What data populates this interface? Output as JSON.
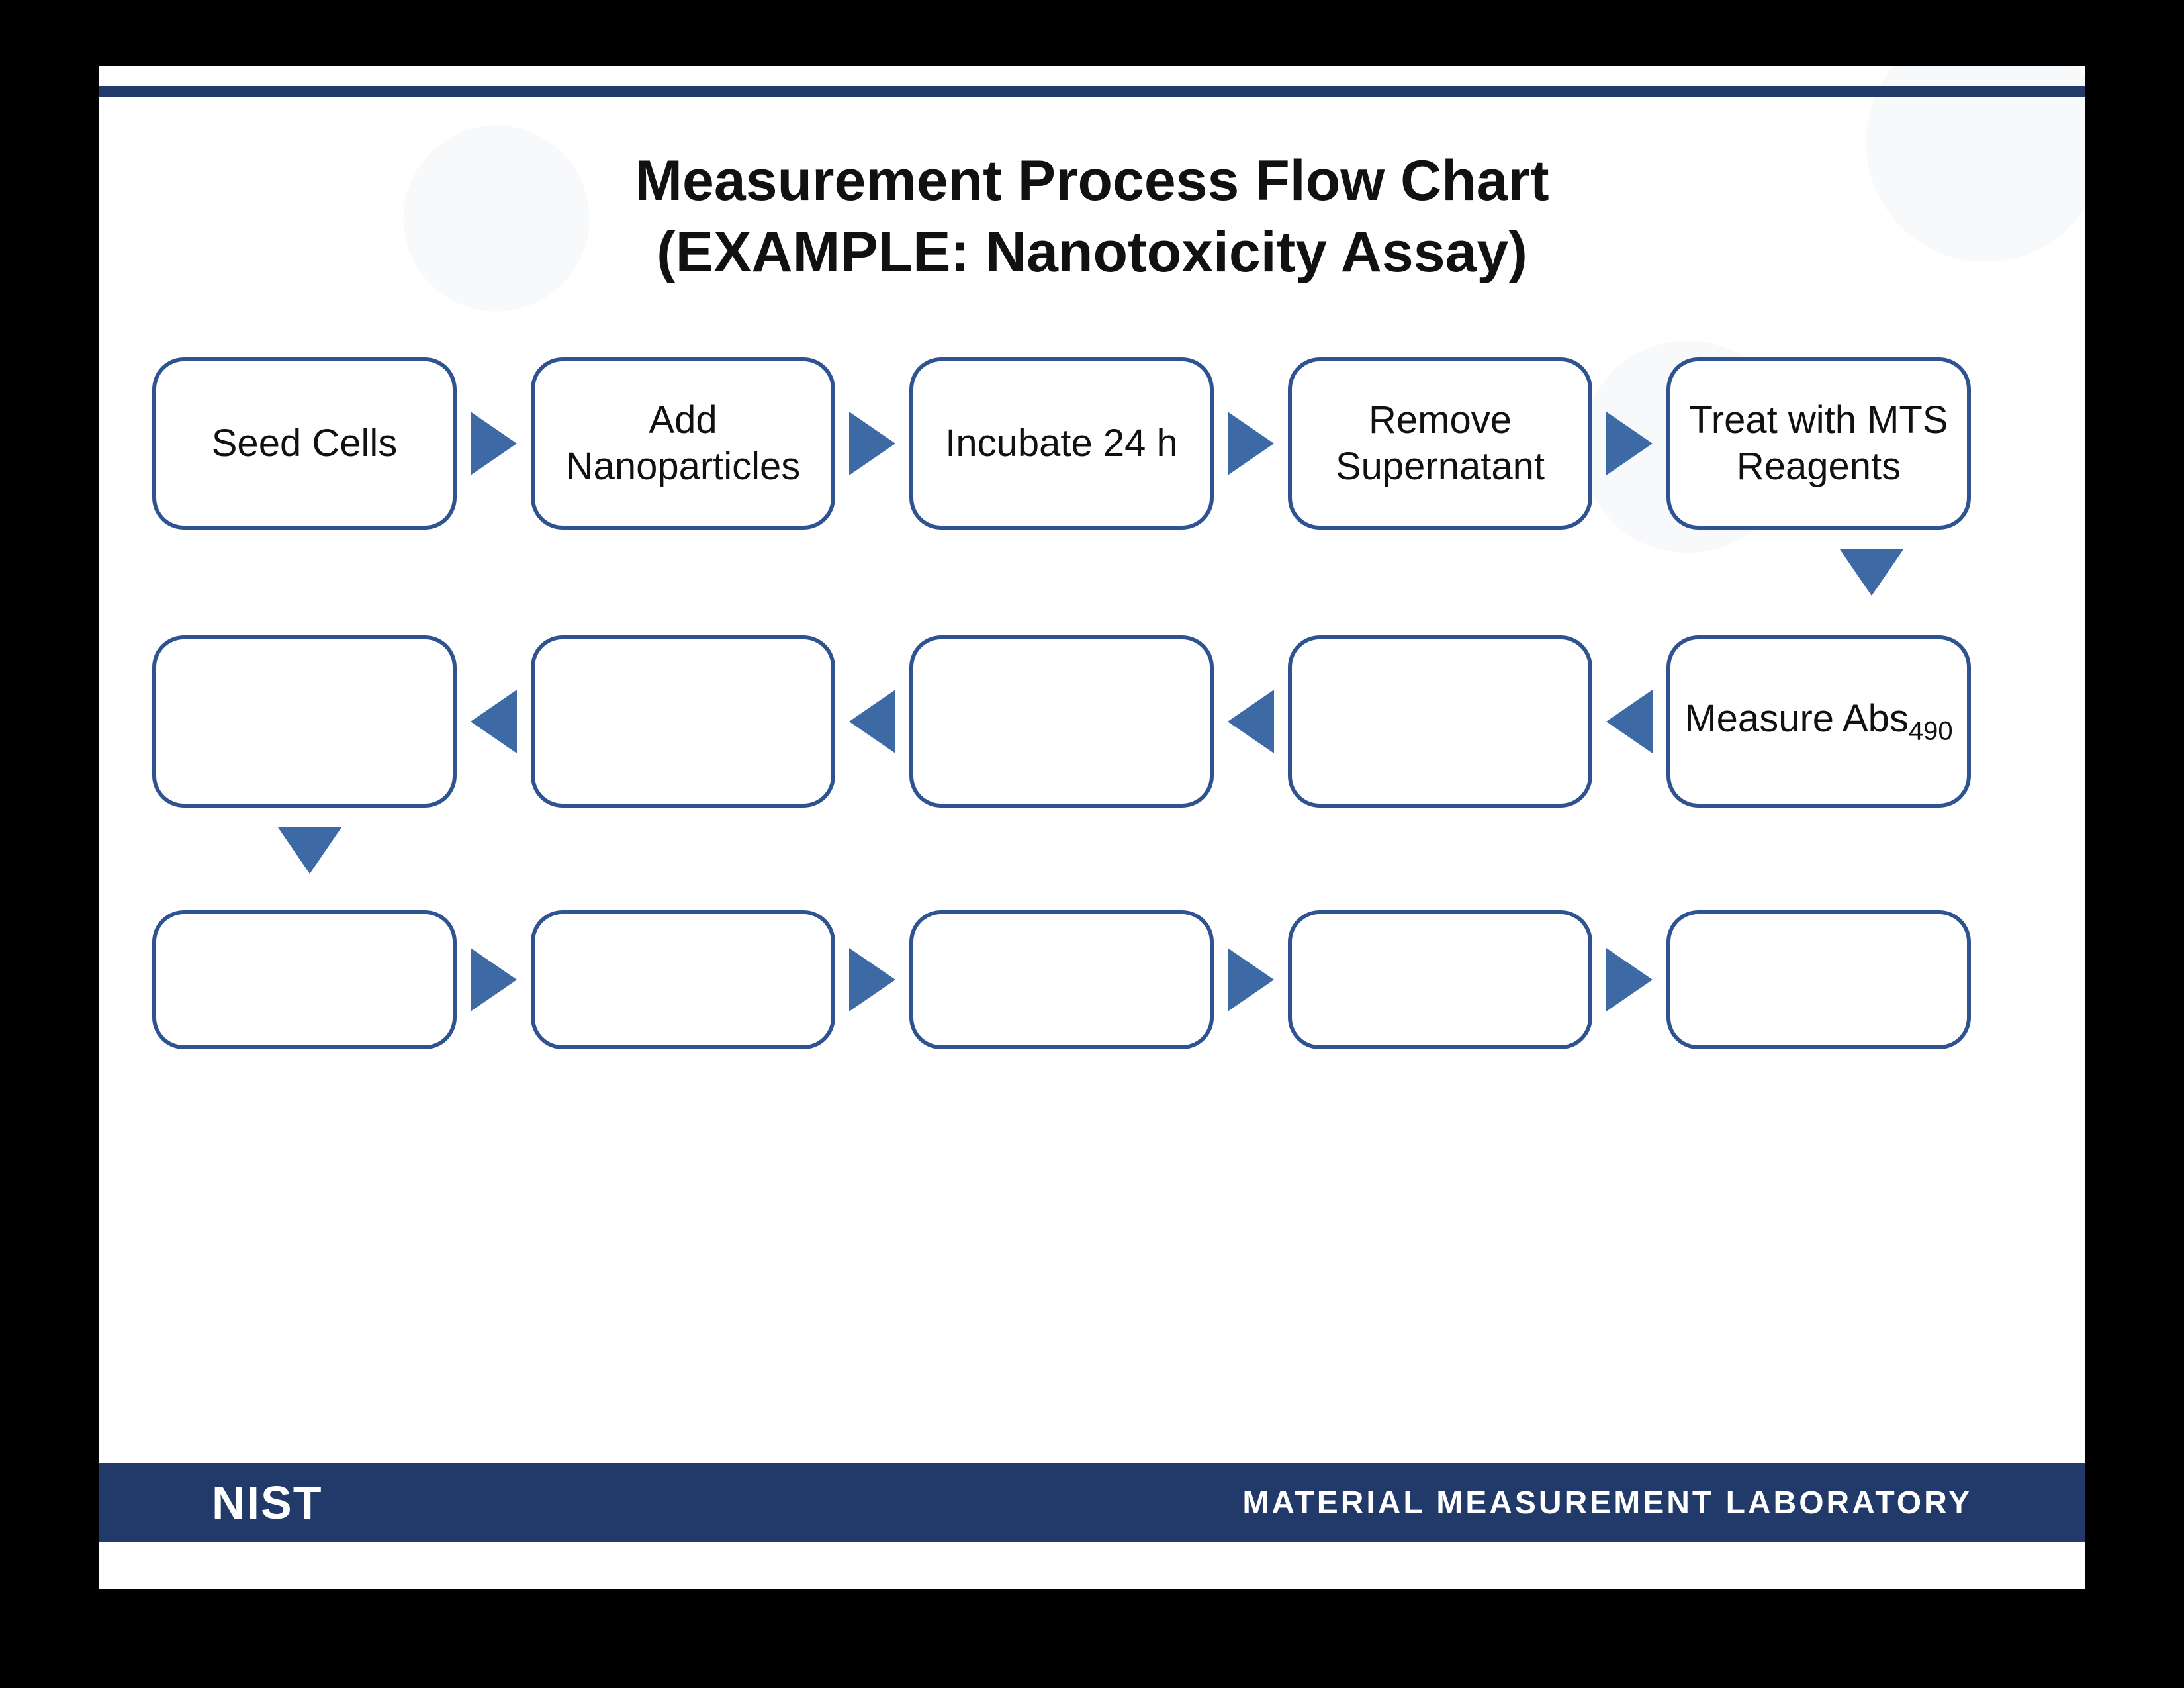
{
  "title": {
    "line1": "Measurement Process Flow Chart",
    "line2": "(EXAMPLE: Nanotoxicity Assay)"
  },
  "footer": {
    "logo_text": "NIST",
    "lab_text": "MATERIAL MEASUREMENT LABORATORY"
  },
  "flow": {
    "row1": [
      "Seed Cells",
      "Add Nanoparticles",
      "Incubate 24 h",
      "Remove Supernatant",
      "Treat with MTS Reagents"
    ],
    "row2_right_to_left": [
      "Measure Abs₄₉₀",
      "",
      "",
      "",
      ""
    ],
    "row3": [
      "",
      "",
      "",
      "",
      ""
    ],
    "measure_label_main": "Measure Abs",
    "measure_label_sub": "490"
  },
  "colors": {
    "border": "#2f5391",
    "arrow": "#3d6aa5",
    "bar": "#223a6a"
  }
}
